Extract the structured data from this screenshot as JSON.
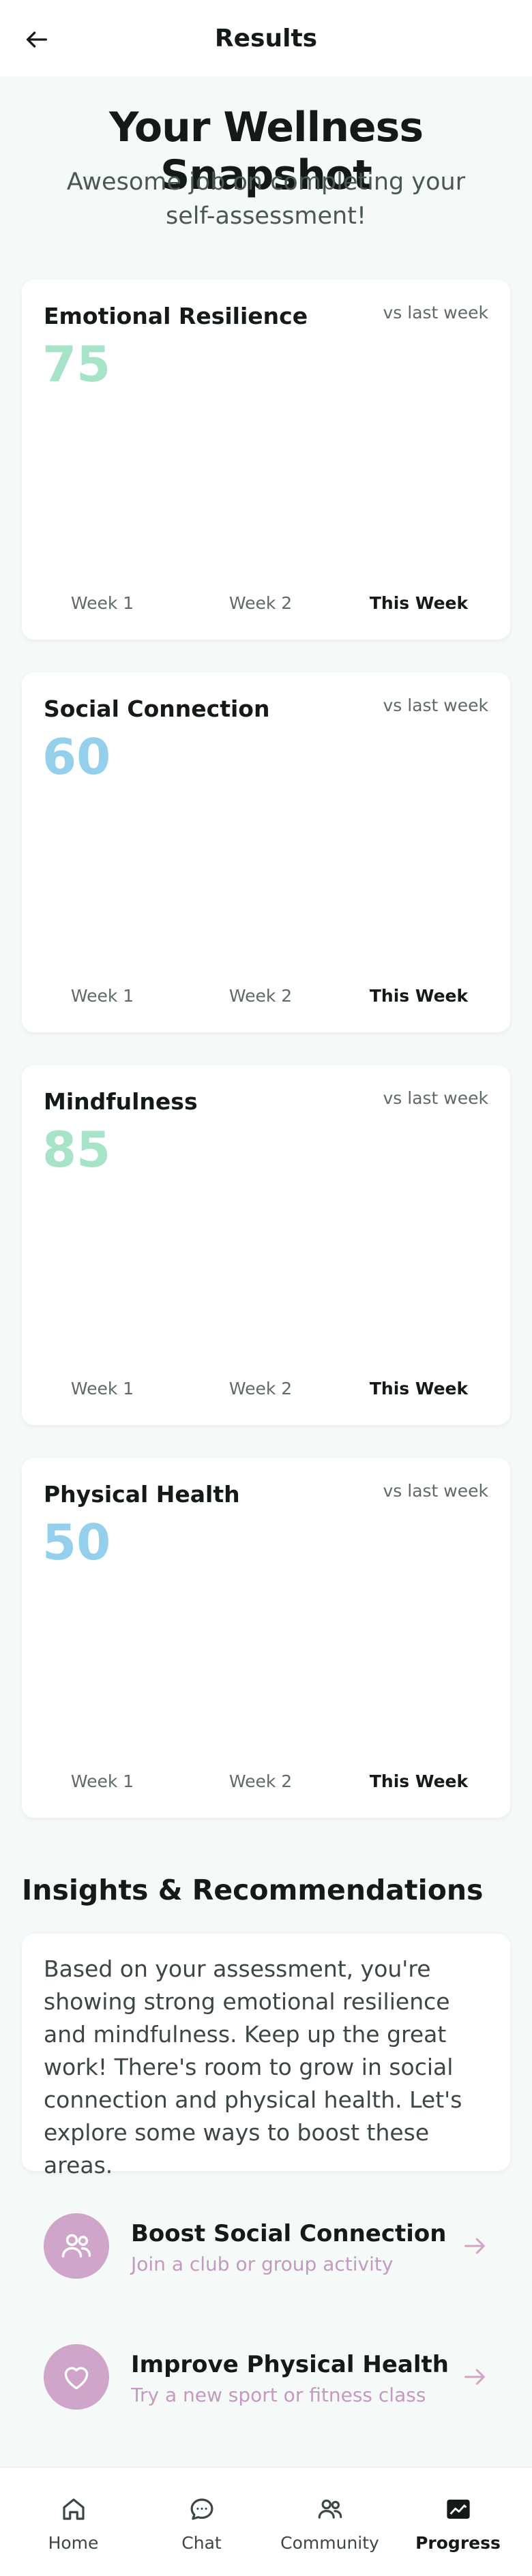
{
  "header": {
    "title": "Results"
  },
  "hero": {
    "title": "Your Wellness Snapshot",
    "subtitle": "Awesome job on completing your self-assessment!"
  },
  "cards": [
    {
      "title": "Emotional Resilience",
      "score": "75",
      "score_color": "#a6e3c7",
      "vs": "vs last week",
      "weeks": [
        "Week 1",
        "Week 2",
        "This Week"
      ]
    },
    {
      "title": "Social Connection",
      "score": "60",
      "score_color": "#94cfeb",
      "vs": "vs last week",
      "weeks": [
        "Week 1",
        "Week 2",
        "This Week"
      ]
    },
    {
      "title": "Mindfulness",
      "score": "85",
      "score_color": "#a6e3c7",
      "vs": "vs last week",
      "weeks": [
        "Week 1",
        "Week 2",
        "This Week"
      ]
    },
    {
      "title": "Physical Health",
      "score": "50",
      "score_color": "#94cfeb",
      "vs": "vs last week",
      "weeks": [
        "Week 1",
        "Week 2",
        "This Week"
      ]
    }
  ],
  "insights": {
    "title": "Insights & Recommendations",
    "text": "Based on your assessment, you're showing strong emotional resilience and mindfulness. Keep up the great work! There's room to grow in social connection and physical health. Let's explore some ways to boost these areas."
  },
  "recommendations": [
    {
      "title": "Boost Social Connection",
      "subtitle": "Join a club or group activity",
      "icon": "people-icon"
    },
    {
      "title": "Improve Physical Health",
      "subtitle": "Try a new sport or fitness class",
      "icon": "heart-icon"
    }
  ],
  "tabbar": {
    "items": [
      {
        "label": "Home",
        "icon": "home-icon"
      },
      {
        "label": "Chat",
        "icon": "chat-icon"
      },
      {
        "label": "Community",
        "icon": "community-icon"
      },
      {
        "label": "Progress",
        "icon": "progress-icon",
        "active": true
      }
    ]
  },
  "colors": {
    "accent_green": "#a6e3c7",
    "accent_blue": "#94cfeb",
    "accent_mauve": "#cfa6c9"
  }
}
